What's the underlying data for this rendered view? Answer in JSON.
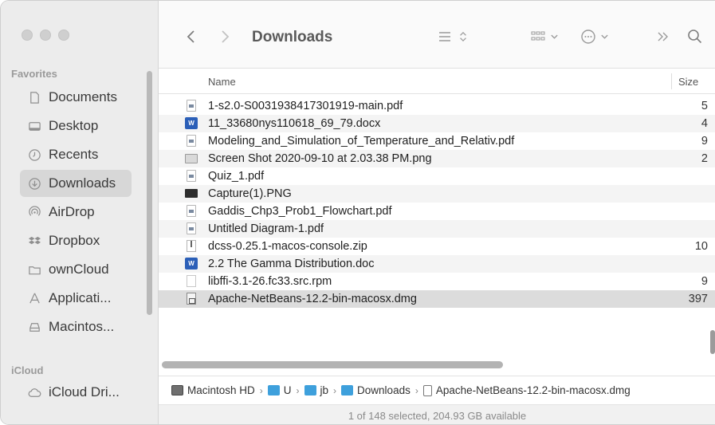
{
  "toolbar": {
    "title": "Downloads",
    "back_icon": "chevron-left-icon",
    "forward_icon": "chevron-right-icon",
    "view_icon": "list-view-icon",
    "group_icon": "group-icon",
    "action_icon": "ellipsis-circle-icon",
    "more_icon": "double-chevron-icon",
    "search_icon": "search-icon"
  },
  "sidebar": {
    "favorites_label": "Favorites",
    "icloud_label": "iCloud",
    "items": [
      {
        "label": "Documents",
        "icon": "document-icon"
      },
      {
        "label": "Desktop",
        "icon": "desktop-icon"
      },
      {
        "label": "Recents",
        "icon": "clock-icon"
      },
      {
        "label": "Downloads",
        "icon": "download-icon"
      },
      {
        "label": "AirDrop",
        "icon": "airdrop-icon"
      },
      {
        "label": "Dropbox",
        "icon": "dropbox-icon"
      },
      {
        "label": "ownCloud",
        "icon": "folder-icon"
      },
      {
        "label": "Applicati...",
        "icon": "applications-icon"
      },
      {
        "label": "Macintos...",
        "icon": "disk-icon"
      }
    ],
    "icloud_items": [
      {
        "label": "iCloud Dri...",
        "icon": "cloud-icon"
      }
    ],
    "active_index": 3
  },
  "columns": {
    "name": "Name",
    "size": "Size"
  },
  "files": [
    {
      "name": "1-s2.0-S0031938417301919-main.pdf",
      "size": "5",
      "type": "pdf"
    },
    {
      "name": "11_33680nys110618_69_79.docx",
      "size": "4",
      "type": "doc"
    },
    {
      "name": "Modeling_and_Simulation_of_Temperature_and_Relativ.pdf",
      "size": "9",
      "type": "pdf"
    },
    {
      "name": "Screen Shot 2020-09-10 at 2.03.38 PM.png",
      "size": "2",
      "type": "png"
    },
    {
      "name": "Quiz_1.pdf",
      "size": "",
      "type": "pdf"
    },
    {
      "name": "Capture(1).PNG",
      "size": "",
      "type": "png2"
    },
    {
      "name": "Gaddis_Chp3_Prob1_Flowchart.pdf",
      "size": "",
      "type": "pdf"
    },
    {
      "name": "Untitled Diagram-1.pdf",
      "size": "",
      "type": "pdf"
    },
    {
      "name": "dcss-0.25.1-macos-console.zip",
      "size": "10",
      "type": "zip"
    },
    {
      "name": "2.2 The Gamma Distribution.doc",
      "size": "",
      "type": "doc"
    },
    {
      "name": "libffi-3.1-26.fc33.src.rpm",
      "size": "9",
      "type": "blank"
    },
    {
      "name": "Apache-NetBeans-12.2-bin-macosx.dmg",
      "size": "397",
      "type": "dmg"
    }
  ],
  "selected_file_index": 11,
  "pathbar": [
    {
      "label": "Macintosh HD",
      "icon": "hd"
    },
    {
      "label": "U",
      "icon": "folder"
    },
    {
      "label": "jb",
      "icon": "folder"
    },
    {
      "label": "Downloads",
      "icon": "folder"
    },
    {
      "label": "Apache-NetBeans-12.2-bin-macosx.dmg",
      "icon": "file"
    }
  ],
  "status": "1 of 148 selected, 204.93 GB available"
}
